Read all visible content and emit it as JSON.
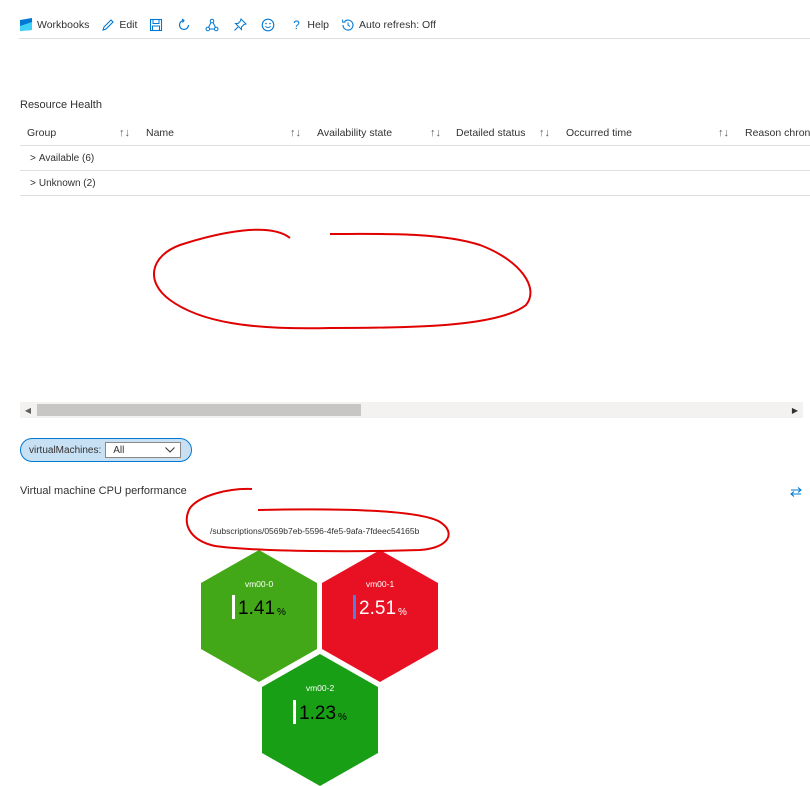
{
  "toolbar": {
    "workbooks": "Workbooks",
    "edit": "Edit",
    "help": "Help",
    "auto_refresh": "Auto refresh: Off"
  },
  "resource_health": {
    "title": "Resource Health",
    "columns": [
      "Group",
      "Name",
      "Availability state",
      "Detailed status",
      "Occurred time",
      "Reason chron"
    ],
    "rows": [
      {
        "label": "Available (6)"
      },
      {
        "label": "Unknown (2)"
      }
    ]
  },
  "parameter": {
    "label": "virtualMachines:",
    "selected": "All"
  },
  "cpu": {
    "title": "Virtual machine CPU performance",
    "subscription_path": "/subscriptions/0569b7eb-5596-4fe5-9afa-7fdeec54165b",
    "tiles": [
      {
        "name": "vm00-0",
        "value": "1.41",
        "unit": "%",
        "color": "#43a817"
      },
      {
        "name": "vm00-1",
        "value": "2.51",
        "unit": "%",
        "color": "#e81123"
      },
      {
        "name": "vm00-2",
        "value": "1.23",
        "unit": "%",
        "color": "#189f15"
      }
    ]
  },
  "colors": {
    "accent": "#0078d4",
    "annotation": "#e00000"
  }
}
